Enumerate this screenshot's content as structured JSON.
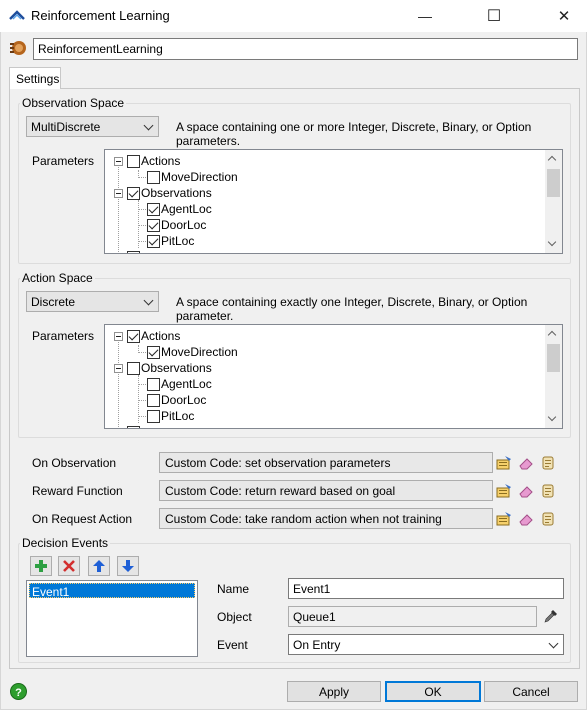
{
  "window": {
    "title": "Reinforcement Learning",
    "minimize": "—",
    "maximize": "☐",
    "close": "✕",
    "app_icon": "reinforcement-learning-icon"
  },
  "object_name": "ReinforcementLearning",
  "tabs": [
    {
      "label": "Settings",
      "selected": true
    }
  ],
  "observation_space": {
    "title": "Observation Space",
    "type": "MultiDiscrete",
    "description": "A space containing one or more Integer, Discrete, Binary, or Option parameters.",
    "parameters_label": "Parameters",
    "tree": [
      {
        "label": "Actions",
        "checked": false,
        "level": 0,
        "expander": true
      },
      {
        "label": "MoveDirection",
        "checked": false,
        "level": 1
      },
      {
        "label": "Observations",
        "checked": true,
        "level": 0,
        "expander": true
      },
      {
        "label": "AgentLoc",
        "checked": true,
        "level": 1
      },
      {
        "label": "DoorLoc",
        "checked": true,
        "level": 1
      },
      {
        "label": "PitLoc",
        "checked": true,
        "level": 1
      }
    ]
  },
  "action_space": {
    "title": "Action Space",
    "type": "Discrete",
    "description": "A space containing exactly one Integer, Discrete, Binary, or Option parameter.",
    "parameters_label": "Parameters",
    "tree": [
      {
        "label": "Actions",
        "checked": true,
        "level": 0,
        "expander": true
      },
      {
        "label": "MoveDirection",
        "checked": true,
        "level": 1
      },
      {
        "label": "Observations",
        "checked": false,
        "level": 0,
        "expander": true
      },
      {
        "label": "AgentLoc",
        "checked": false,
        "level": 1
      },
      {
        "label": "DoorLoc",
        "checked": false,
        "level": 1
      },
      {
        "label": "PitLoc",
        "checked": false,
        "level": 1
      }
    ]
  },
  "triggers": [
    {
      "label": "On Observation",
      "value": "Custom Code: set observation parameters"
    },
    {
      "label": "Reward Function",
      "value": "Custom Code: return reward based on goal"
    },
    {
      "label": "On Request Action",
      "value": "Custom Code: take random action when not training"
    }
  ],
  "decision_events": {
    "title": "Decision Events",
    "toolbar": {
      "add": "add-icon",
      "remove": "remove-icon",
      "up": "arrow-up-icon",
      "down": "arrow-down-icon"
    },
    "items": [
      "Event1"
    ],
    "name_label": "Name",
    "name_value": "Event1",
    "object_label": "Object",
    "object_value": "Queue1",
    "event_label": "Event",
    "event_value": "On Entry"
  },
  "footer": {
    "apply": "Apply",
    "ok": "OK",
    "cancel": "Cancel"
  },
  "colors": {
    "selection": "#0078d7",
    "help_icon": "#2e9e2e",
    "add_icon": "#2ea043",
    "remove_icon": "#d32f2f",
    "arrow_icon": "#1e5fd6"
  }
}
